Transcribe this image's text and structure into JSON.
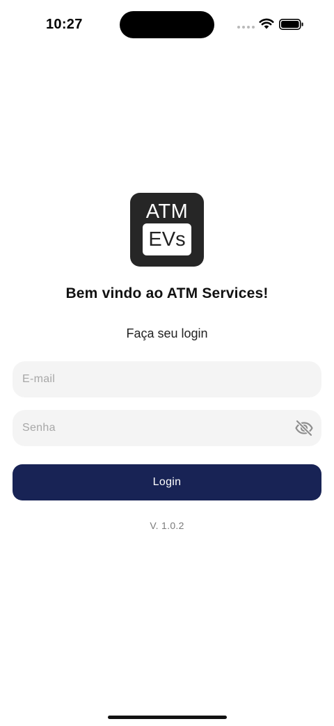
{
  "status_bar": {
    "time": "10:27",
    "icons": [
      "signal-dots-icon",
      "wifi-icon",
      "battery-icon"
    ]
  },
  "logo": {
    "line1": "ATM",
    "line2": "EVs",
    "background_color": "#262626"
  },
  "welcome": {
    "title": "Bem vindo ao ATM Services!",
    "subtitle": "Faça seu login"
  },
  "form": {
    "email": {
      "value": "",
      "placeholder": "E-mail"
    },
    "password": {
      "value": "",
      "placeholder": "Senha",
      "toggle_icon": "eye-off-icon"
    },
    "login_label": "Login",
    "button_color": "#182355"
  },
  "footer": {
    "version": "V. 1.0.2"
  }
}
